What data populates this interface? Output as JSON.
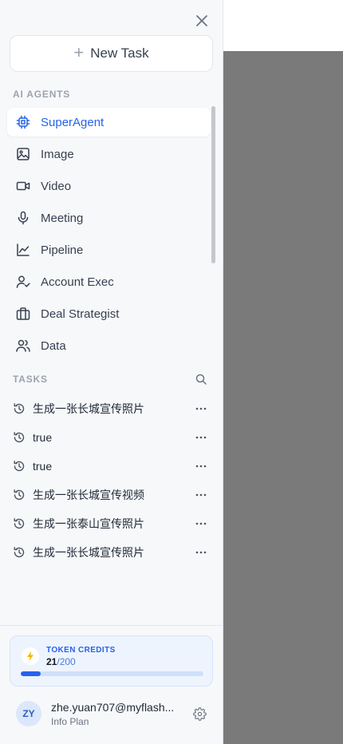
{
  "new_task": {
    "plus": "+",
    "label": "New Task"
  },
  "agents": {
    "title": "AI AGENTS",
    "items": [
      {
        "label": "SuperAgent",
        "icon": "chip-icon",
        "active": true
      },
      {
        "label": "Image",
        "icon": "image-icon"
      },
      {
        "label": "Video",
        "icon": "video-icon"
      },
      {
        "label": "Meeting",
        "icon": "microphone-icon"
      },
      {
        "label": "Pipeline",
        "icon": "line-chart-icon"
      },
      {
        "label": "Account Exec",
        "icon": "user-check-icon"
      },
      {
        "label": "Deal Strategist",
        "icon": "briefcase-icon"
      },
      {
        "label": "Data",
        "icon": "users-icon"
      }
    ]
  },
  "tasks": {
    "title": "TASKS",
    "items": [
      {
        "label": "生成一张长城宣传照片"
      },
      {
        "label": "true"
      },
      {
        "label": "true"
      },
      {
        "label": "生成一张长城宣传视频"
      },
      {
        "label": "生成一张泰山宣传照片"
      },
      {
        "label": "生成一张长城宣传照片"
      }
    ]
  },
  "credits": {
    "label": "TOKEN CREDITS",
    "used": "21",
    "total": "/200",
    "fraction": 0.105,
    "accent": "#2563eb"
  },
  "user": {
    "initials": "ZY",
    "email": "zhe.yuan707@myflash...",
    "plan": "Info Plan"
  },
  "colors": {
    "accent": "#2563eb",
    "sidebar_bg": "#f7f8fa",
    "overlay": "#7a7a7a"
  }
}
